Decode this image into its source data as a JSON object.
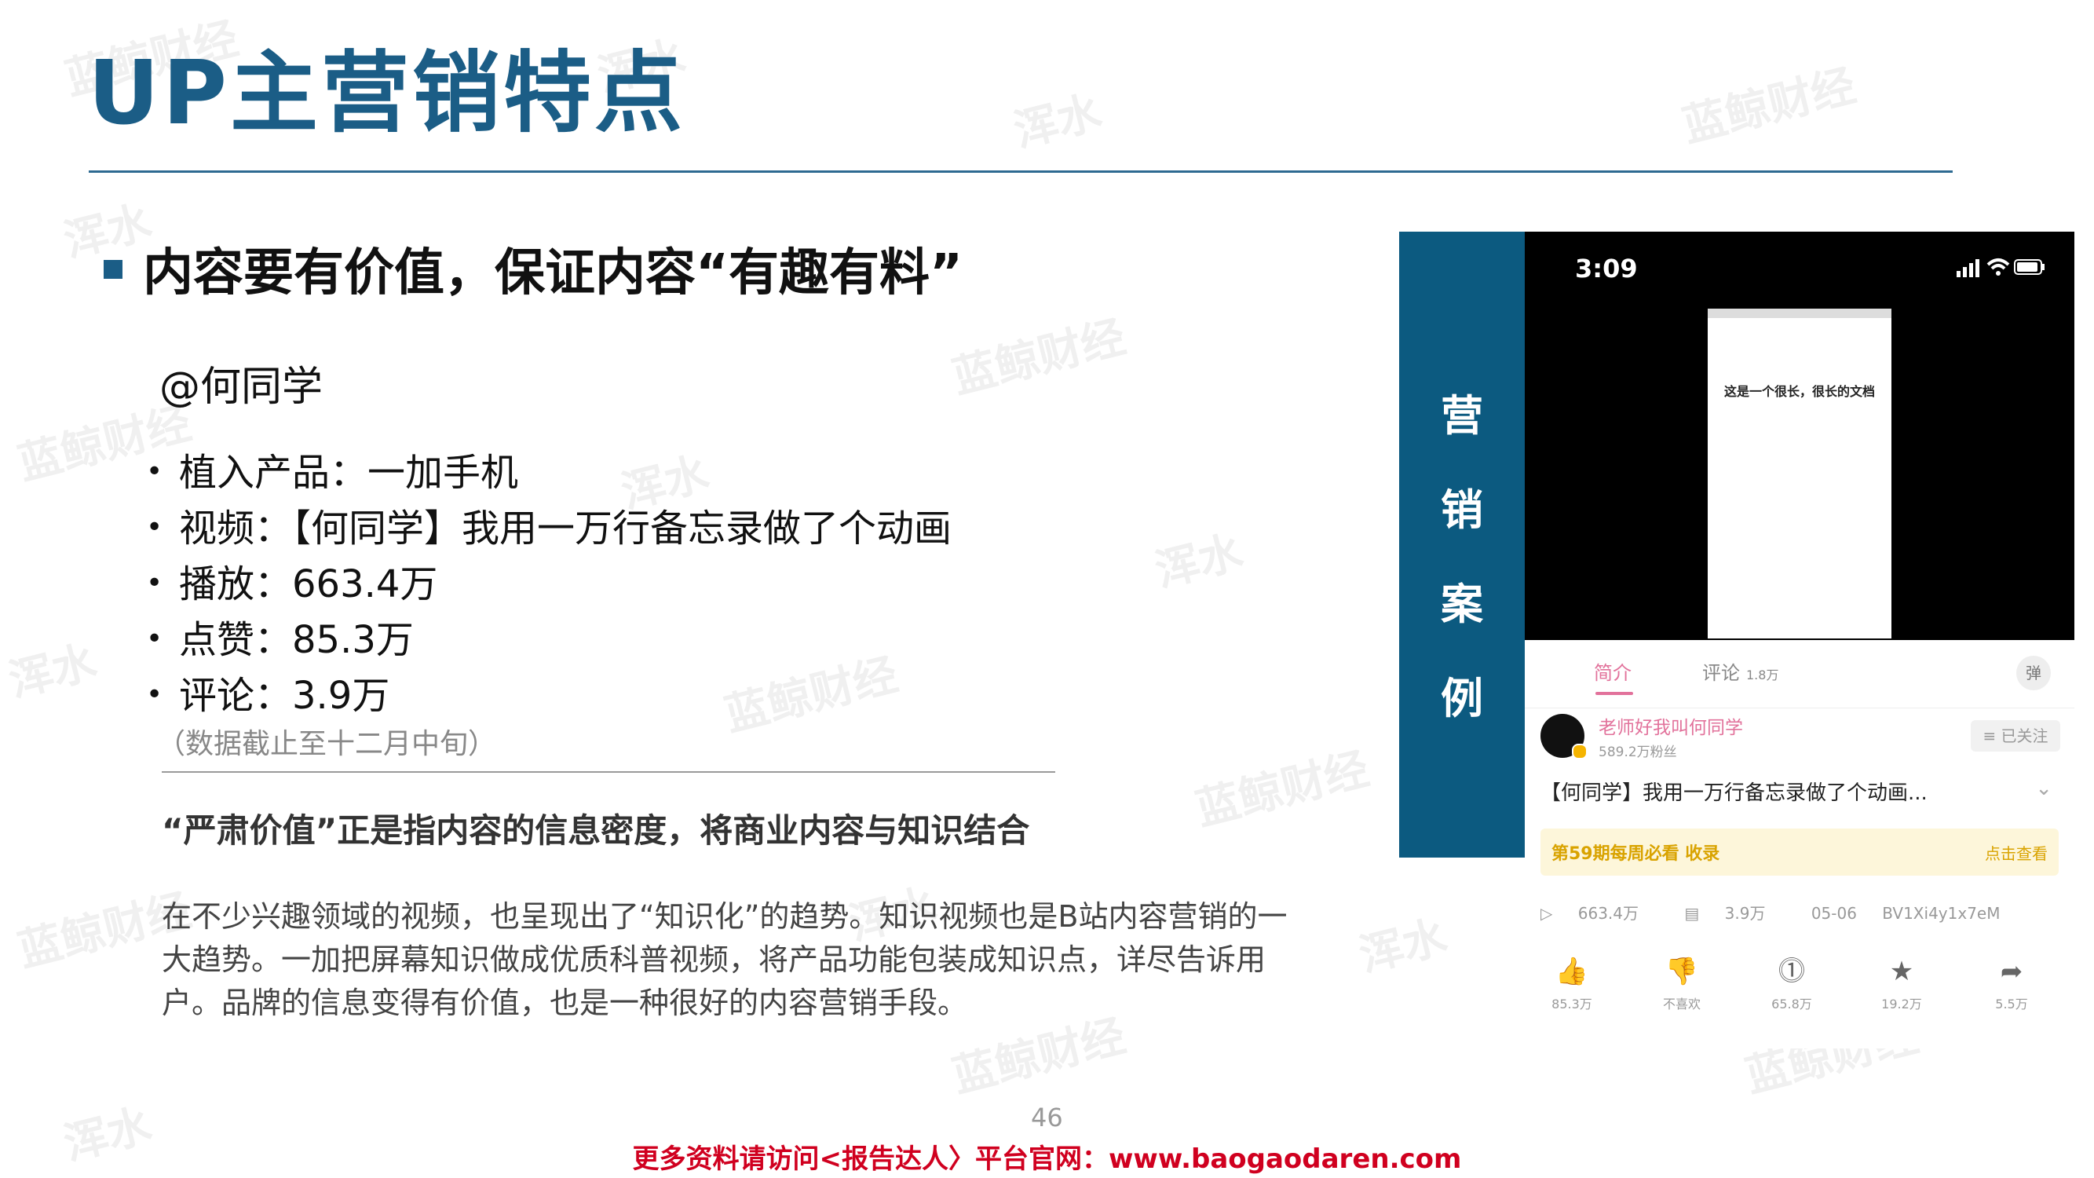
{
  "slide": {
    "title": "UP主营销特点",
    "subhead": "内容要有价值，保证内容“有趣有料”",
    "handle": "@何同学",
    "bullets": [
      "植入产品：一加手机",
      "视频：【何同学】我用一万行备忘录做了个动画",
      "播放：663.4万",
      "点赞：85.3万",
      "评论：3.9万"
    ],
    "note": "（数据截止至十二月中旬）",
    "quote": "“严肃价值”正是指内容的信息密度，将商业内容与知识结合",
    "paragraph": "在不少兴趣领域的视频，也呈现出了“知识化”的趋势。知识视频也是B站内容营销的一大趋势。一加把屏幕知识做成优质科普视频，将产品功能包装成知识点，详尽告诉用户。品牌的信息变得有价值，也是一种很好的内容营销手段。",
    "page_number": "46",
    "footer": "更多资料请访问<报告达人〉平台官网：www.baogaodaren.com",
    "watermarks": [
      "蓝鲸财经",
      "浑水"
    ]
  },
  "case_label": [
    "营",
    "销",
    "案",
    "例"
  ],
  "phone": {
    "time": "3:09",
    "doc_text": "这是一个很长，很长的文档",
    "tab_intro": "简介",
    "tab_comments": "评论",
    "tab_comments_count": "1.8万",
    "danmu_icon": "弹",
    "up_name": "老师好我叫何同学",
    "up_fans": "589.2万粉丝",
    "follow_label": "≡ 已关注",
    "video_title": "【何同学】我用一万行备忘录做了个动画...",
    "chevron": "⌄",
    "banner_left": "第59期每周必看 收录",
    "banner_right": "点击查看",
    "stats": [
      "663.4万",
      "3.9万",
      "05-06",
      "BV1Xi4y1x7eM"
    ],
    "actions": [
      {
        "icon": "thumb-up-icon",
        "glyph": "👍",
        "label": "85.3万"
      },
      {
        "icon": "thumb-down-icon",
        "glyph": "👎",
        "label": "不喜欢"
      },
      {
        "icon": "coin-icon",
        "glyph": "⓵",
        "label": "65.8万"
      },
      {
        "icon": "star-icon",
        "glyph": "★",
        "label": "19.2万"
      },
      {
        "icon": "share-icon",
        "glyph": "➦",
        "label": "5.5万"
      }
    ]
  },
  "colors": {
    "title": "#1b5d86",
    "case_bar": "#0c5a80",
    "footer": "#d0001f",
    "accent_pink": "#e2729b"
  }
}
